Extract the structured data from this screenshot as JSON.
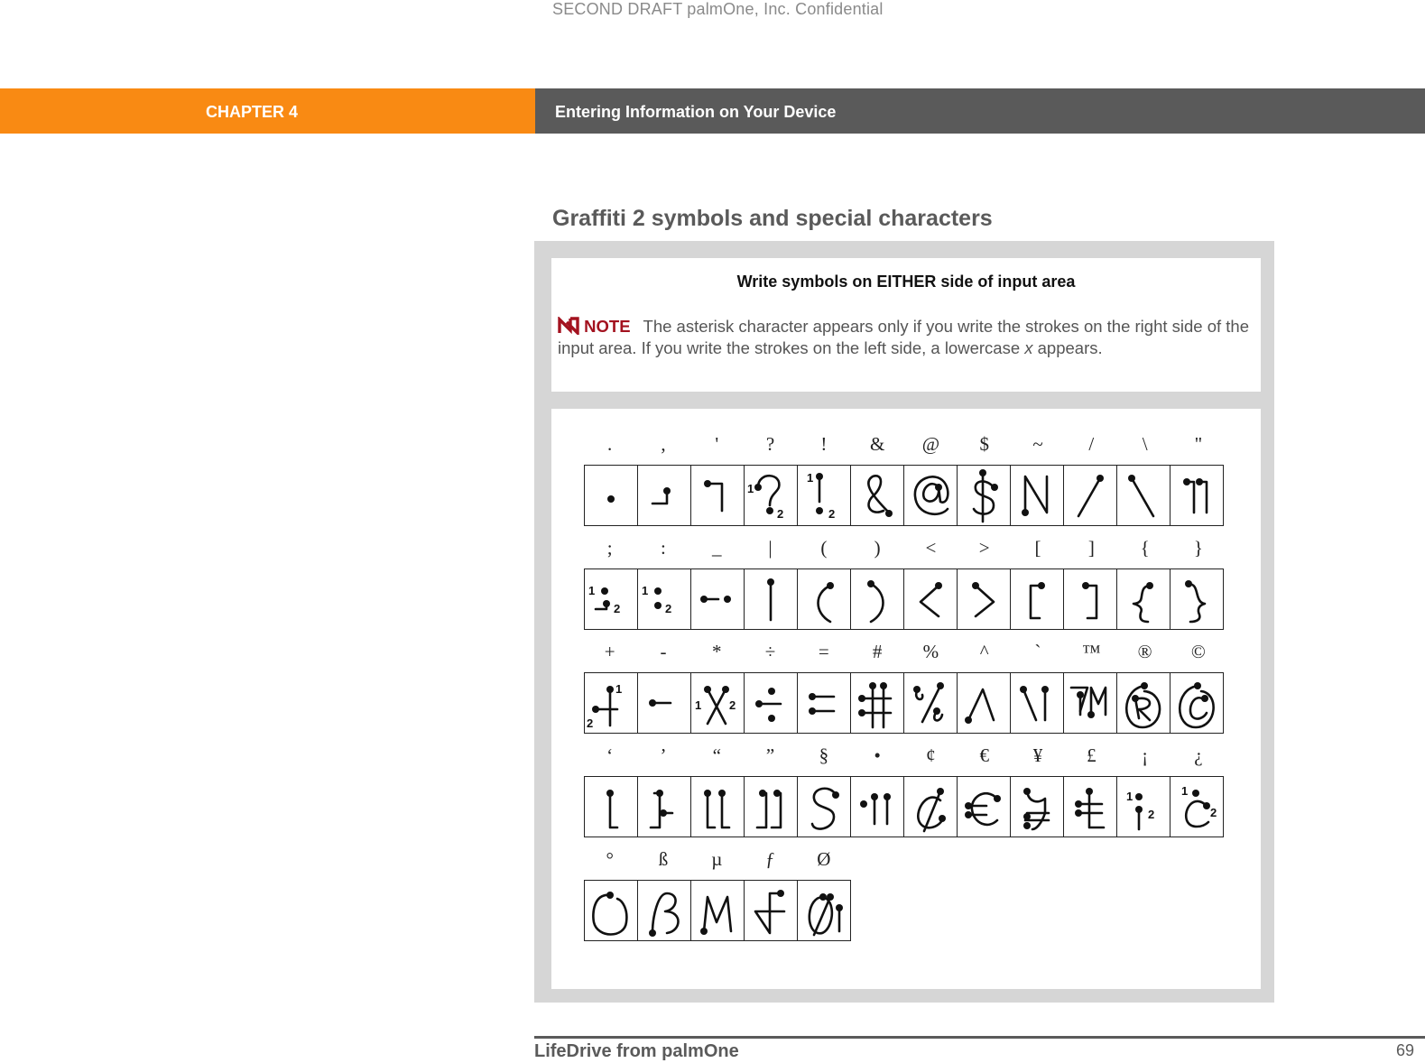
{
  "watermark": "SECOND DRAFT palmOne, Inc.  Confidential",
  "header": {
    "chapter_label": "CHAPTER 4",
    "chapter_title": "Entering Information on Your Device",
    "colors": {
      "chapter_bg": "#f98a13",
      "title_bg": "#5a5a5a"
    }
  },
  "section": {
    "title": "Graffiti 2 symbols and special characters"
  },
  "info": {
    "heading": "Write symbols on EITHER side of input area",
    "note_label": "NOTE",
    "note_text_before": "The asterisk character appears only if you write the strokes on the right side of the input area. If you write the strokes on the left side, a lowercase ",
    "note_text_italic": "x",
    "note_text_after": " appears.",
    "note_color": "#a3121f"
  },
  "symbols": {
    "rows": [
      {
        "labels": [
          ".",
          ",",
          "'",
          "?",
          "!",
          "&",
          "@",
          "$",
          "~",
          "/",
          "\\",
          "\""
        ],
        "strokes": [
          "dot",
          "comma",
          "apostrophe",
          "question",
          "exclaim",
          "ampersand",
          "at",
          "dollar",
          "tilde",
          "slash",
          "backslash",
          "quote"
        ]
      },
      {
        "labels": [
          ";",
          ":",
          "_",
          "|",
          "(",
          ")",
          "<",
          ">",
          "[",
          "]",
          "{",
          "}"
        ],
        "strokes": [
          "semicolon",
          "colon",
          "underscore",
          "pipe",
          "lparen",
          "rparen",
          "lt",
          "gt",
          "lbracket",
          "rbracket",
          "lbrace",
          "rbrace"
        ]
      },
      {
        "labels": [
          "+",
          "-",
          "*",
          "÷",
          "=",
          "#",
          "%",
          "^",
          "`",
          "™",
          "®",
          "©"
        ],
        "strokes": [
          "plus",
          "minus",
          "asterisk",
          "divide",
          "equals",
          "hash",
          "percent",
          "caret",
          "backtick",
          "trademark",
          "registered",
          "copyright"
        ]
      },
      {
        "labels": [
          "‘",
          "’",
          "“",
          "”",
          "§",
          "•",
          "¢",
          "€",
          "¥",
          "£",
          "¡",
          "¿"
        ],
        "strokes": [
          "lsquo",
          "rsquo",
          "ldquo",
          "rdquo",
          "section",
          "bullet",
          "cent",
          "euro",
          "yen",
          "pound",
          "iexcl",
          "iquest"
        ]
      },
      {
        "labels": [
          "°",
          "ß",
          "µ",
          "ƒ",
          "Ø"
        ],
        "strokes": [
          "degree",
          "eszett",
          "mu",
          "florin",
          "oslash"
        ]
      }
    ]
  },
  "footer": {
    "book_title": "LifeDrive from palmOne",
    "page_number": "69"
  }
}
